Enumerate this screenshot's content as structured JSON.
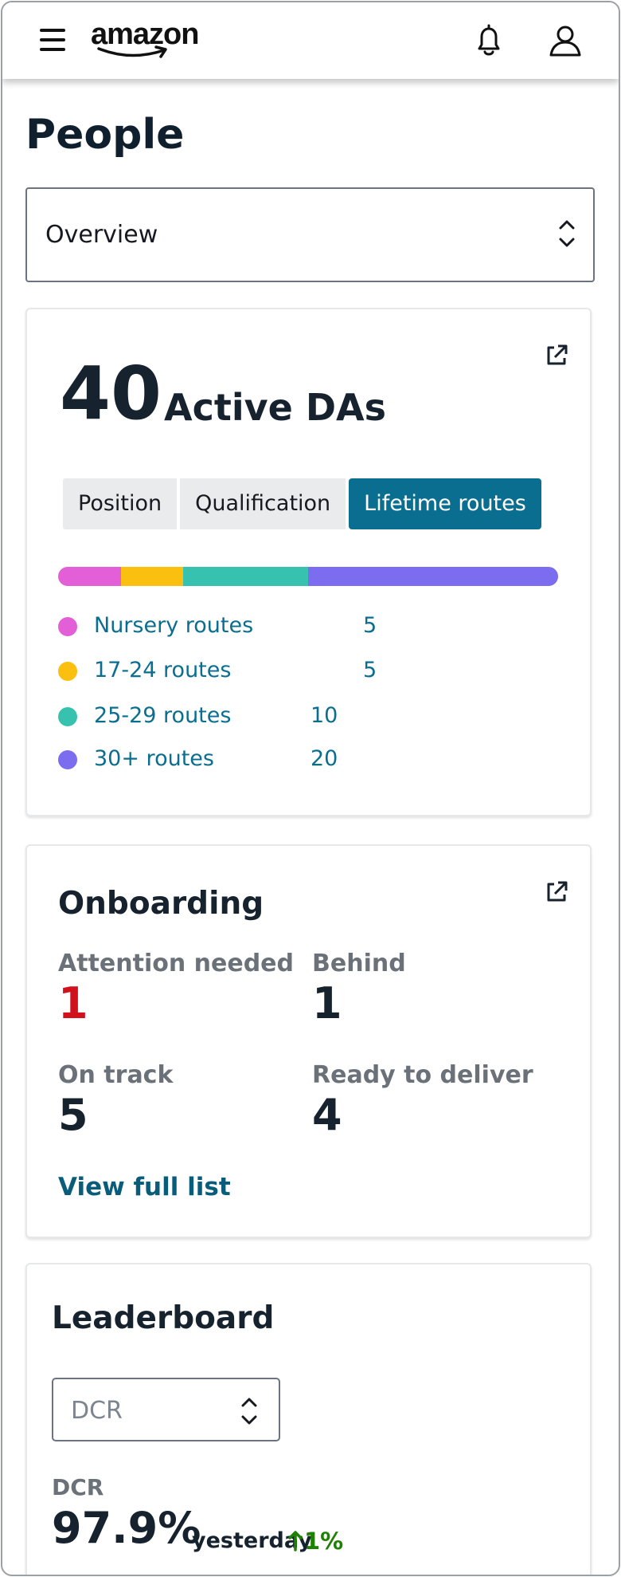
{
  "header": {
    "logo_text": "amazon",
    "menu_icon": "menu-icon",
    "notifications_icon": "bell-icon",
    "profile_icon": "user-icon"
  },
  "page": {
    "title": "People",
    "view_select": {
      "value": "Overview"
    }
  },
  "active_das": {
    "count": "40",
    "label": "Active DAs",
    "tabs": [
      {
        "label": "Position",
        "active": false
      },
      {
        "label": "Qualification",
        "active": false
      },
      {
        "label": "Lifetime routes",
        "active": true
      }
    ],
    "breakdown": [
      {
        "label": "Nursery routes",
        "value": "5",
        "color": "#e35fd8"
      },
      {
        "label": "17-24 routes",
        "value": "5",
        "color": "#fbbf0f"
      },
      {
        "label": "25-29 routes",
        "value": "10",
        "color": "#37c2b0"
      },
      {
        "label": "30+ routes",
        "value": "20",
        "color": "#7b6cf0"
      }
    ]
  },
  "onboarding": {
    "title": "Onboarding",
    "stats": [
      {
        "label": "Attention needed",
        "value": "1",
        "alert": true
      },
      {
        "label": "Behind",
        "value": "1",
        "alert": false
      },
      {
        "label": "On track",
        "value": "5",
        "alert": false
      },
      {
        "label": "Ready to deliver",
        "value": "4",
        "alert": false
      }
    ],
    "link": "View full list"
  },
  "leaderboard": {
    "title": "Leaderboard",
    "metric_select": {
      "value": "DCR"
    },
    "kpi_label": "DCR",
    "kpi_value": "97.9%",
    "kpi_period": "yesterday",
    "kpi_change": "1%",
    "kpi_change_direction": "up",
    "kpi_change_color": "#1d8102"
  }
}
